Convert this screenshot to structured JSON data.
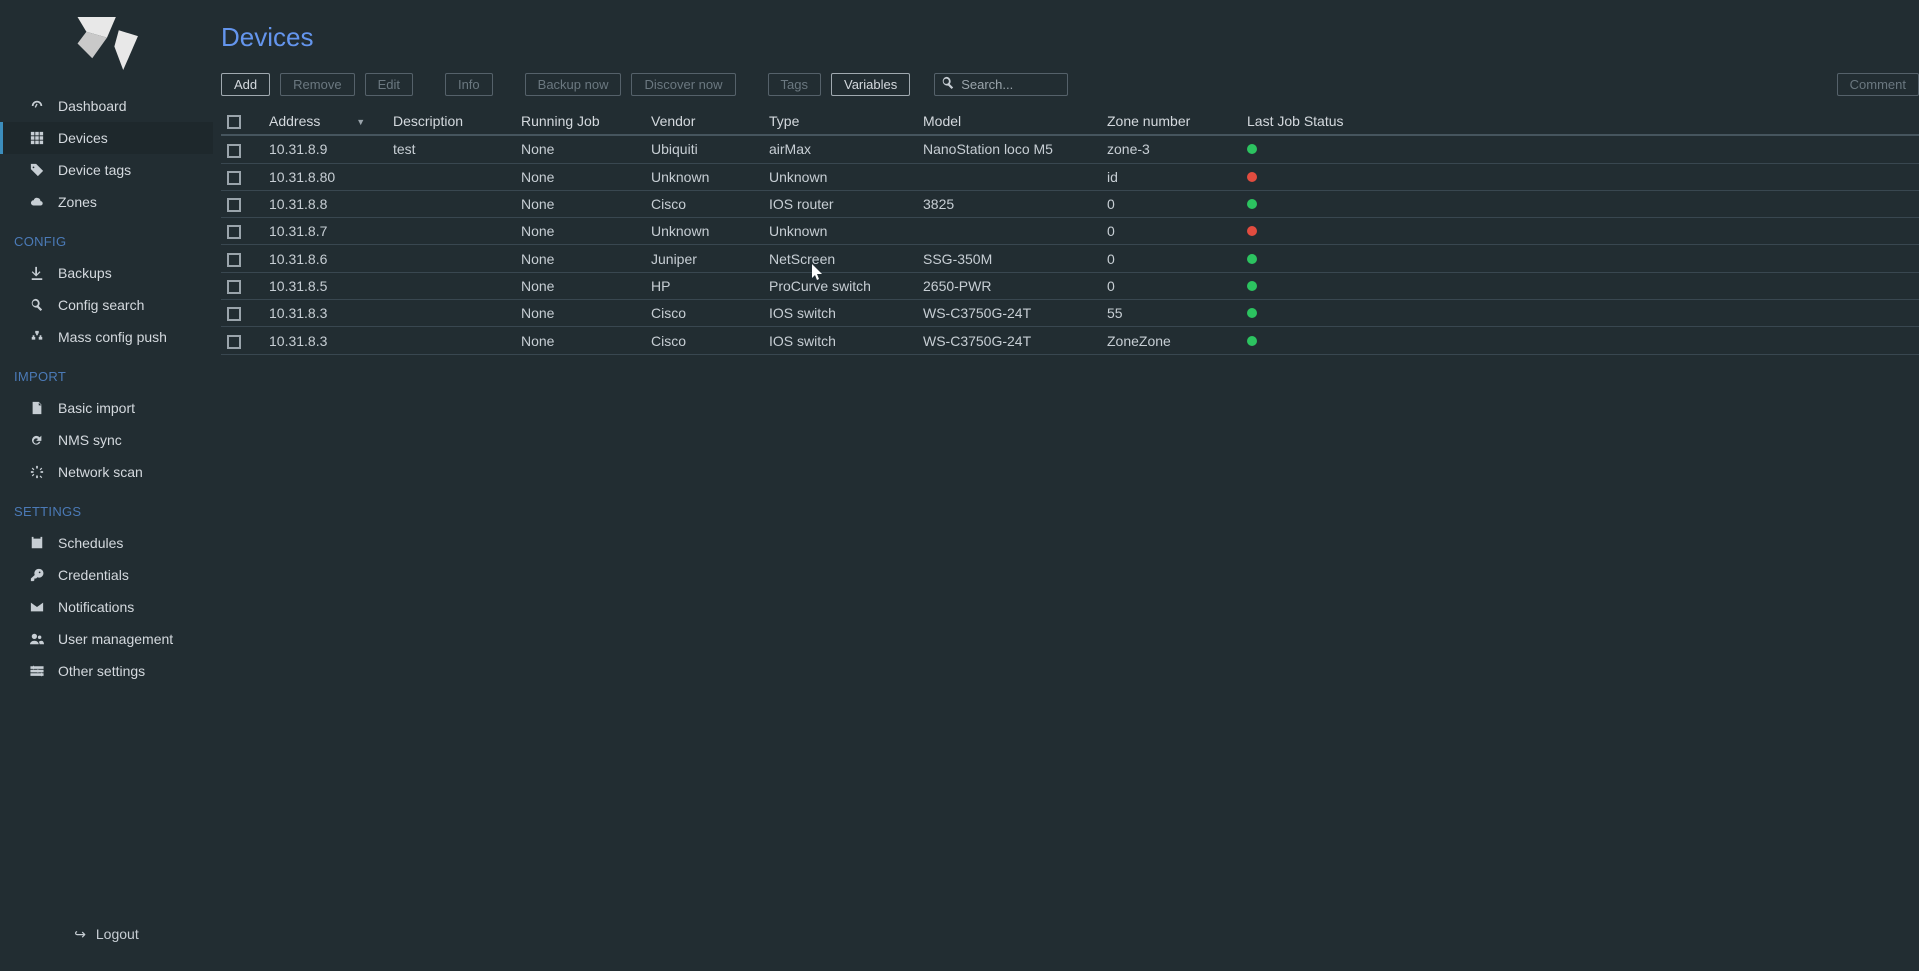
{
  "page": {
    "title": "Devices"
  },
  "sidebar": {
    "items": [
      {
        "label": "Dashboard",
        "icon": "dashboard",
        "active": false
      },
      {
        "label": "Devices",
        "icon": "grid",
        "active": true
      },
      {
        "label": "Device tags",
        "icon": "tag",
        "active": false
      },
      {
        "label": "Zones",
        "icon": "cloud",
        "active": false
      }
    ],
    "config_header": "CONFIG",
    "config_items": [
      {
        "label": "Backups",
        "icon": "download"
      },
      {
        "label": "Config search",
        "icon": "search"
      },
      {
        "label": "Mass config push",
        "icon": "sitemap"
      }
    ],
    "import_header": "IMPORT",
    "import_items": [
      {
        "label": "Basic import",
        "icon": "file"
      },
      {
        "label": "NMS sync",
        "icon": "refresh"
      },
      {
        "label": "Network scan",
        "icon": "scan"
      }
    ],
    "settings_header": "SETTINGS",
    "settings_items": [
      {
        "label": "Schedules",
        "icon": "calendar"
      },
      {
        "label": "Credentials",
        "icon": "key"
      },
      {
        "label": "Notifications",
        "icon": "mail"
      },
      {
        "label": "User management",
        "icon": "users"
      },
      {
        "label": "Other settings",
        "icon": "sliders"
      }
    ],
    "logout": "Logout"
  },
  "toolbar": {
    "add": "Add",
    "remove": "Remove",
    "edit": "Edit",
    "info": "Info",
    "backup_now": "Backup now",
    "discover_now": "Discover now",
    "tags": "Tags",
    "variables": "Variables",
    "search_placeholder": "Search...",
    "comment": "Comment"
  },
  "table": {
    "columns": {
      "address": "Address",
      "description": "Description",
      "running_job": "Running Job",
      "vendor": "Vendor",
      "type": "Type",
      "model": "Model",
      "zone_number": "Zone number",
      "last_job_status": "Last Job Status"
    },
    "rows": [
      {
        "address": "10.31.8.9",
        "description": "test",
        "running_job": "None",
        "vendor": "Ubiquiti",
        "type": "airMax",
        "model": "NanoStation loco M5",
        "zone": "zone-3",
        "status": "green"
      },
      {
        "address": "10.31.8.80",
        "description": "",
        "running_job": "None",
        "vendor": "Unknown",
        "type": "Unknown",
        "model": "",
        "zone": "id",
        "status": "red"
      },
      {
        "address": "10.31.8.8",
        "description": "",
        "running_job": "None",
        "vendor": "Cisco",
        "type": "IOS router",
        "model": "3825",
        "zone": "0",
        "status": "green"
      },
      {
        "address": "10.31.8.7",
        "description": "",
        "running_job": "None",
        "vendor": "Unknown",
        "type": "Unknown",
        "model": "",
        "zone": "0",
        "status": "red"
      },
      {
        "address": "10.31.8.6",
        "description": "",
        "running_job": "None",
        "vendor": "Juniper",
        "type": "NetScreen",
        "model": "SSG-350M",
        "zone": "0",
        "status": "green"
      },
      {
        "address": "10.31.8.5",
        "description": "",
        "running_job": "None",
        "vendor": "HP",
        "type": "ProCurve switch",
        "model": "2650-PWR",
        "zone": "0",
        "status": "green"
      },
      {
        "address": "10.31.8.3",
        "description": "",
        "running_job": "None",
        "vendor": "Cisco",
        "type": "IOS switch",
        "model": "WS-C3750G-24T",
        "zone": "55",
        "status": "green"
      },
      {
        "address": "10.31.8.3",
        "description": "",
        "running_job": "None",
        "vendor": "Cisco",
        "type": "IOS switch",
        "model": "WS-C3750G-24T",
        "zone": "ZoneZone",
        "status": "green"
      }
    ]
  },
  "colors": {
    "status_green": "#2cc360",
    "status_red": "#e24c3f",
    "accent": "#6495ed"
  }
}
